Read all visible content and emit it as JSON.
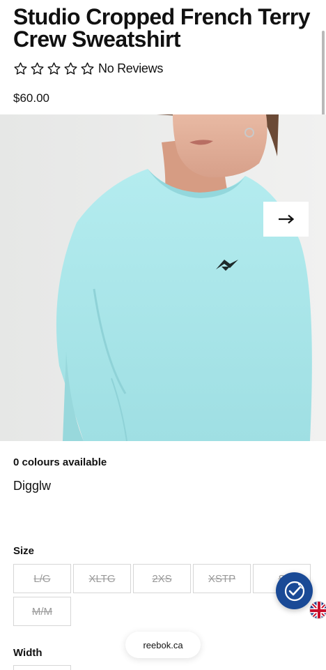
{
  "product": {
    "title": "Studio Cropped French Terry Crew Sweatshirt",
    "rating_text": "No Reviews",
    "rating_value": 0,
    "rating_max": 5,
    "price": "$60.00"
  },
  "gallery": {
    "next_icon": "arrow-right-icon"
  },
  "colours": {
    "available_label": "0 colours available",
    "selected": "Digglw"
  },
  "size": {
    "label": "Size",
    "options": [
      "L/G",
      "XLTG",
      "2XS",
      "XSTP",
      "S",
      "M/M"
    ]
  },
  "width": {
    "label": "Width"
  },
  "browser": {
    "url": "reebok.ca"
  },
  "icons": {
    "accessibility_badge": "accessibility-checkmark-icon",
    "language_flag": "uk-flag-icon"
  },
  "colors": {
    "sweatshirt": "#a9e6ea",
    "badge": "#1a4a96",
    "text": "#111111",
    "disabled": "#9a9a9a"
  }
}
